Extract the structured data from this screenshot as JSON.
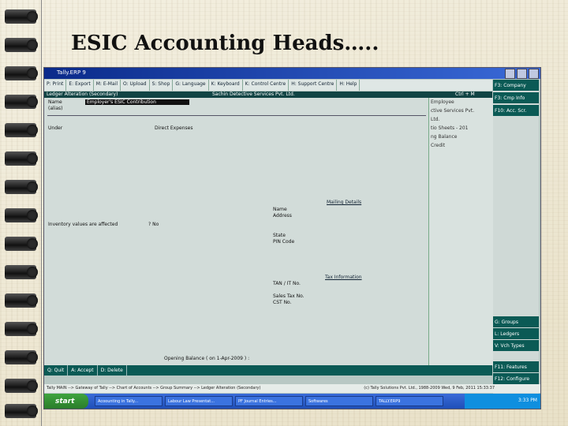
{
  "slide_title": "ESIC Accounting Heads…..",
  "window": {
    "title": "Tally.ERP 9",
    "menu": [
      "P: Print",
      "E: Export",
      "M: E-Mail",
      "O: Upload",
      "S: Shop",
      "G: Language",
      "K: Keyboard",
      "K: Control Centre",
      "H: Support Centre",
      "H: Help"
    ],
    "screen_title": "Ledger Alteration (Secondary)",
    "company_name": "Sachin Detective Services Pvt. Ltd.",
    "ctrl_m": "Ctrl + M",
    "name_label": "Name",
    "name_value": "Employer's ESIC Contribution",
    "alias_label": "(alias)",
    "under_label": "Under",
    "under_value": "Direct Expenses",
    "inventory_label": "Inventory values are affected",
    "inventory_value": "? No",
    "mailing_title": "Mailing Details",
    "mailing_name": "Name",
    "mailing_address": "Address",
    "mailing_state": "State",
    "mailing_pin": "PIN Code",
    "tax_title": "Tax Information",
    "tax_tan": "TAN / IT No.",
    "tax_sales": "Sales Tax No.",
    "tax_cst": "CST No.",
    "opening_balance": "Opening Balance  ( on 1-Apr-2009 ) :",
    "right_panel": [
      "Employee",
      "ctive Services Pvt.",
      "Ltd.",
      "tio Sheets - 201",
      "ng Balance",
      "Credit"
    ],
    "fkeys_top": [
      "F3: Company",
      "F3: Cmp Info",
      "F10: Acc. Scr."
    ],
    "fkeys_bottom": [
      "G: Groups",
      "L: Ledgers",
      "V: Vch Types",
      "F11: Features",
      "F12: Configure"
    ],
    "bottom_buttons": [
      "Q: Quit",
      "A: Accept",
      "D: Delete"
    ],
    "status_left": "Tally MAIN --> Gateway of Tally --> Chart of Accounts --> Group Summary --> Ledger Alteration (Secondary)",
    "status_right": "(c) Tally Solutions Pvt. Ltd., 1988-2009   Wed, 9 Feb, 2011   15:33:37",
    "taskbar": {
      "start": "start",
      "tasks": [
        "Acoounting in Tally...",
        "Labour Law Presentat...",
        "PF Journal Entries...",
        "Softwares",
        "TALLY.ERP9"
      ],
      "clock": "3:33 PM"
    }
  }
}
